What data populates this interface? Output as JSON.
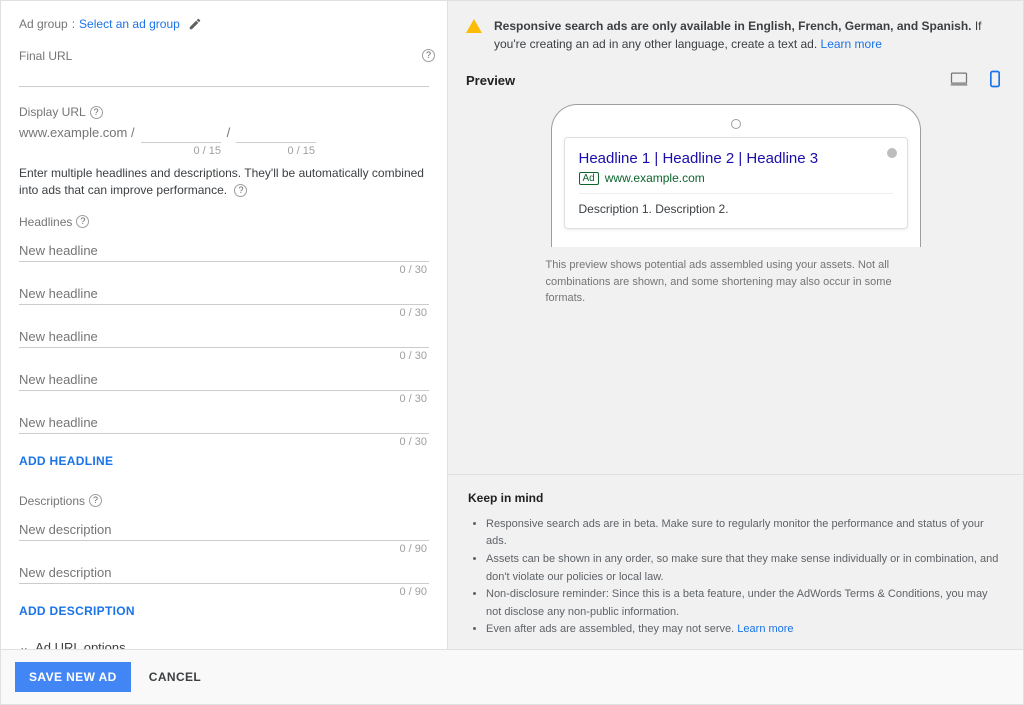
{
  "adGroup": {
    "label": "Ad group",
    "selectText": "Select an ad group"
  },
  "finalUrl": {
    "label": "Final URL",
    "value": ""
  },
  "displayUrl": {
    "label": "Display URL",
    "prefix": "www.example.com /",
    "sep": "/",
    "counter1": "0 / 15",
    "counter2": "0 / 15"
  },
  "introText": "Enter multiple headlines and descriptions. They'll be automatically combined into ads that can improve performance.",
  "headlinesSection": {
    "label": "Headlines",
    "placeholder": "New headline",
    "counter": "0 / 30",
    "addLabel": "ADD HEADLINE"
  },
  "descriptionsSection": {
    "label": "Descriptions",
    "placeholder": "New description",
    "counter": "0 / 90",
    "addLabel": "ADD DESCRIPTION"
  },
  "adUrlOptions": "Ad URL options",
  "banner": {
    "bold": "Responsive search ads are only available in English, French, German, and Spanish.",
    "rest": " If you're creating an ad in any other language, create a text ad. ",
    "learnMore": "Learn more"
  },
  "preview": {
    "title": "Preview",
    "headline": "Headline 1 | Headline 2 | Headline 3",
    "adBadge": "Ad",
    "url": "www.example.com",
    "description": "Description 1. Description 2.",
    "note": "This preview shows potential ads assembled using your assets. Not all combinations are shown, and some shortening may also occur in some formats."
  },
  "keep": {
    "title": "Keep in mind",
    "items": [
      "Responsive search ads are in beta. Make sure to regularly monitor the performance and status of your ads.",
      "Assets can be shown in any order, so make sure that they make sense individually or in combination, and don't violate our policies or local law.",
      "Non-disclosure reminder: Since this is a beta feature, under the AdWords Terms & Conditions, you may not disclose any non-public information.",
      "Even after ads are assembled, they may not serve. "
    ],
    "learnMore": "Learn more"
  },
  "footer": {
    "save": "SAVE NEW AD",
    "cancel": "CANCEL"
  }
}
